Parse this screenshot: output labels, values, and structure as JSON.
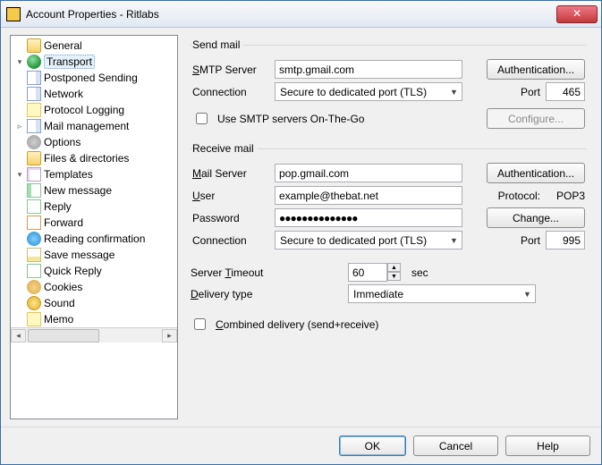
{
  "window": {
    "title": "Account Properties - Ritlabs"
  },
  "tree": {
    "items": [
      {
        "label": "General",
        "icon": "i-folder",
        "indent": 0,
        "tw": ""
      },
      {
        "label": "Transport",
        "icon": "i-globe",
        "indent": 0,
        "tw": "▾",
        "selected": true
      },
      {
        "label": "Postponed Sending",
        "icon": "i-page",
        "indent": 1,
        "tw": ""
      },
      {
        "label": "Network",
        "icon": "i-page",
        "indent": 1,
        "tw": ""
      },
      {
        "label": "Protocol Logging",
        "icon": "i-memo",
        "indent": 1,
        "tw": ""
      },
      {
        "label": "Mail management",
        "icon": "i-page",
        "indent": 0,
        "tw": "▹"
      },
      {
        "label": "Options",
        "icon": "i-gear",
        "indent": 0,
        "tw": ""
      },
      {
        "label": "Files & directories",
        "icon": "i-folder",
        "indent": 0,
        "tw": ""
      },
      {
        "label": "Templates",
        "icon": "i-tpl",
        "indent": 0,
        "tw": "▾"
      },
      {
        "label": "New message",
        "icon": "i-new",
        "indent": 1,
        "tw": ""
      },
      {
        "label": "Reply",
        "icon": "i-reply",
        "indent": 1,
        "tw": ""
      },
      {
        "label": "Forward",
        "icon": "i-fwd",
        "indent": 1,
        "tw": ""
      },
      {
        "label": "Reading confirmation",
        "icon": "i-read",
        "indent": 1,
        "tw": ""
      },
      {
        "label": "Save message",
        "icon": "i-save",
        "indent": 1,
        "tw": ""
      },
      {
        "label": "Quick Reply",
        "icon": "i-qr",
        "indent": 1,
        "tw": ""
      },
      {
        "label": "Cookies",
        "icon": "i-cookie",
        "indent": 1,
        "tw": ""
      },
      {
        "label": "Sound",
        "icon": "i-sound",
        "indent": 0,
        "tw": ""
      },
      {
        "label": "Memo",
        "icon": "i-memo",
        "indent": 0,
        "tw": ""
      }
    ]
  },
  "send": {
    "legend": "Send mail",
    "smtp_label": "SMTP Server",
    "smtp_value": "smtp.gmail.com",
    "auth": "Authentication...",
    "conn_label": "Connection",
    "conn_value": "Secure to dedicated port (TLS)",
    "port_label": "Port",
    "port_value": "465",
    "onthego": "Use SMTP servers On-The-Go",
    "configure": "Configure..."
  },
  "recv": {
    "legend": "Receive mail",
    "server_label": "Mail Server",
    "server_pre": "M",
    "server_post": "ail Server",
    "server_value": "pop.gmail.com",
    "auth": "Authentication...",
    "user_label": "User",
    "user_pre": "U",
    "user_post": "ser",
    "user_value": "example@thebat.net",
    "proto_label": "Protocol:",
    "proto_value": "POP3",
    "pass_label": "Password",
    "pass_value": "●●●●●●●●●●●●●●",
    "change": "Change...",
    "conn_label": "Connection",
    "conn_value": "Secure to dedicated port (TLS)",
    "port_label": "Port",
    "port_value": "995"
  },
  "misc": {
    "timeout_label": "Server Timeout",
    "timeout_pre": "Server ",
    "timeout_u": "T",
    "timeout_post": "imeout",
    "timeout_value": "60",
    "sec": "sec",
    "delivery_label": "Delivery type",
    "delivery_pre": "D",
    "delivery_post": "elivery type",
    "delivery_value": "Immediate",
    "combined": "Combined delivery (send+receive)"
  },
  "footer": {
    "ok": "OK",
    "cancel": "Cancel",
    "help": "Help"
  }
}
